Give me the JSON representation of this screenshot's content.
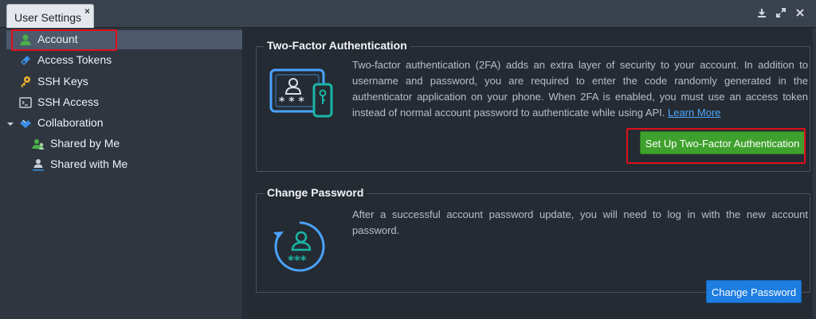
{
  "tab": {
    "title": "User Settings",
    "close_glyph": "×"
  },
  "window_controls": [
    "download-icon",
    "expand-icon",
    "close-icon"
  ],
  "sidebar": {
    "items": [
      {
        "label": "Account",
        "icon": "user-icon",
        "active": true
      },
      {
        "label": "Access Tokens",
        "icon": "token-icon"
      },
      {
        "label": "SSH Keys",
        "icon": "key-icon"
      },
      {
        "label": "SSH Access",
        "icon": "terminal-icon"
      },
      {
        "label": "Collaboration",
        "icon": "handshake-icon",
        "expanded": true
      },
      {
        "label": "Shared by Me",
        "icon": "users-icon"
      },
      {
        "label": "Shared with Me",
        "icon": "user-share-icon"
      }
    ]
  },
  "two_factor": {
    "title": "Two-Factor Authentication",
    "description": "Two-factor authentication (2FA) adds an extra layer of security to your account. In addition to username and password, you are required to enter the code randomly generated in the authenticator application on your phone. When 2FA is enabled, you must use an access token instead of normal account password to authenticate while using API.",
    "link_text": "Learn More",
    "button_label": "Set Up Two-Factor Authentication"
  },
  "change_password": {
    "title": "Change Password",
    "description": "After a successful account password update, you will need to log in with the new account password.",
    "button_label": "Change Password"
  },
  "colors": {
    "accent_green": "#3fa12d",
    "accent_blue": "#1d7de0",
    "icon_blue": "#4aa3ff",
    "icon_teal": "#19b6a6",
    "highlight_red": "#e0101c"
  }
}
